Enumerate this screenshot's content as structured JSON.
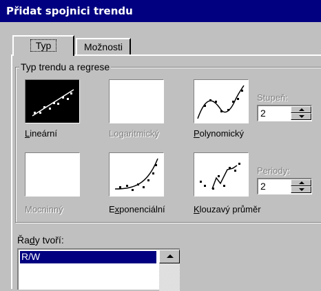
{
  "dialog": {
    "title": "Přidat spojnici trendu"
  },
  "tabs": [
    {
      "label": "Typ",
      "active": true
    },
    {
      "label": "Možnosti",
      "active": false
    }
  ],
  "trend_group": {
    "title": "Typ trendu a regrese",
    "types": [
      {
        "label": "Lineární",
        "accel": "L",
        "rest": "ineární",
        "selected": true,
        "enabled": true
      },
      {
        "label": "Logaritmický",
        "enabled": false
      },
      {
        "label": "Polynomický",
        "accel": "P",
        "rest": "olynomický",
        "enabled": true
      },
      {
        "label": "Mocninný",
        "enabled": false
      },
      {
        "label": "Exponenciální",
        "pre": "E",
        "accel": "x",
        "rest": "ponenciální",
        "enabled": true
      },
      {
        "label": "Klouzavý průměr",
        "accel": "K",
        "rest": "louzavý průměr",
        "enabled": true
      }
    ],
    "order": {
      "label": "Stupeň:",
      "value": "2"
    },
    "period": {
      "label": "Periody:",
      "value": "2"
    }
  },
  "series": {
    "label": "Řady tvoří:",
    "pre": "Řa",
    "accel": "d",
    "rest": "y tvoří:",
    "items": [
      "R/W"
    ],
    "selected": "R/W"
  },
  "colors": {
    "titlebar": "#000080",
    "face": "#c0c0c0",
    "selection": "#000080"
  }
}
